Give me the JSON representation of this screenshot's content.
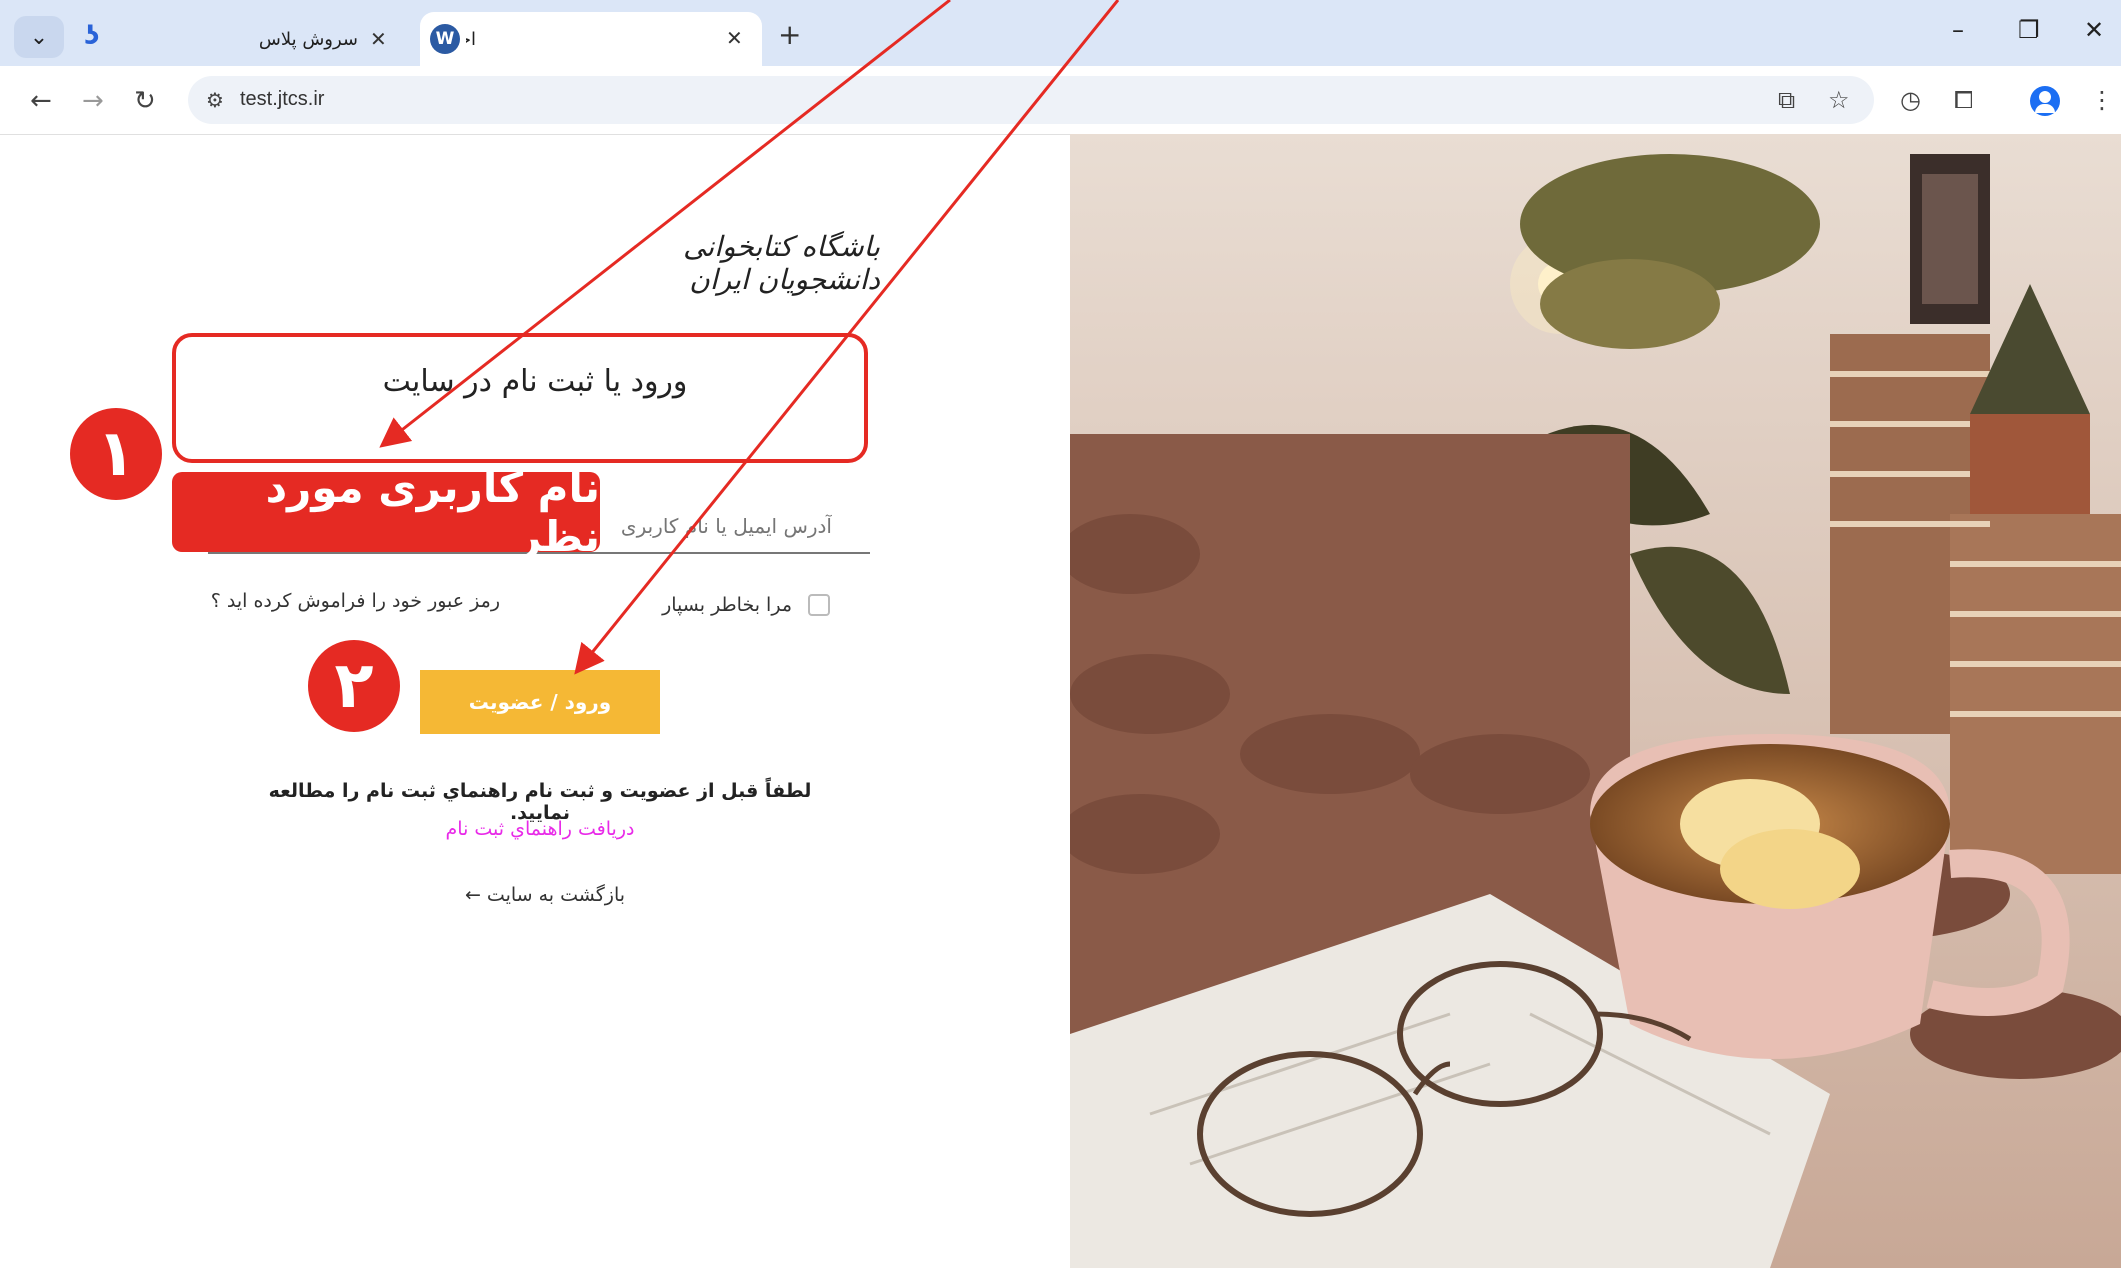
{
  "browser": {
    "tab_menu_icon": "chevron-down-icon",
    "tabs": [
      {
        "label": "سروش پلاس",
        "active": false
      },
      {
        "label": "احراز هویت - آزمون باشگاه کتابخوانی د",
        "active": true
      }
    ],
    "new_tab_symbol": "+",
    "window_controls": [
      "–",
      "❐",
      "✕"
    ],
    "url": "test.jtcs.ir"
  },
  "page": {
    "logo_text": "باشگاه کتابخوانی دانشجویان ایران",
    "login_title": "ورود یا ثبت نام در سایت",
    "username_placeholder": "آدرس ایمیل یا نام کاربری",
    "remember_label": "مرا بخاطر بسپار",
    "forgot_password": "رمز عبور خود را فراموش کرده اید ؟",
    "submit_label": "ورود / عضویت",
    "note_text": "لطفاً قبل از عضویت و ثبت نام راهنماي ثبت نام را مطالعه نمایید.",
    "guide_link": "دریافت راهنماي ثبت نام",
    "back_link": "بازگشت به سایت ←"
  },
  "annotations": {
    "step1_badge": "۱",
    "step2_badge": "۲",
    "username_callout": "نام کاربری مورد نظر",
    "accent_color": "#e52a23"
  },
  "colors": {
    "button": "#f5b835",
    "link": "#e82ae8",
    "tabstrip": "#dbe6f7"
  }
}
